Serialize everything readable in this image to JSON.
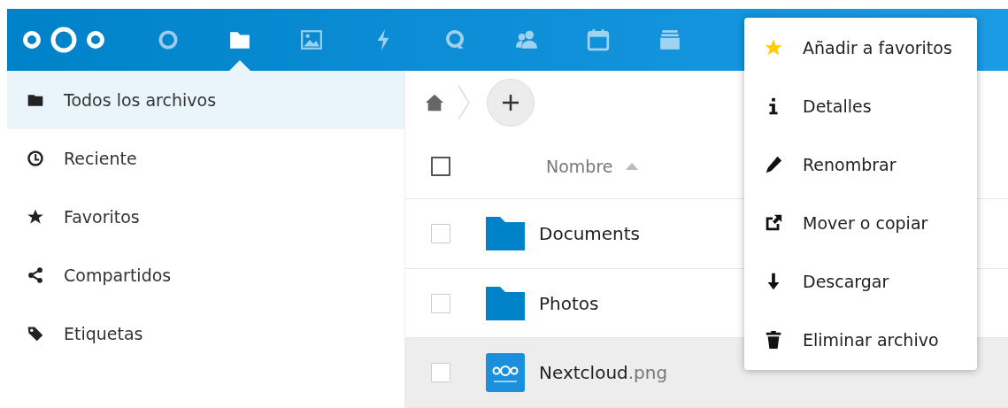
{
  "header": {
    "apps": [
      {
        "kind": "dashboard",
        "selected": false
      },
      {
        "kind": "files",
        "selected": true
      },
      {
        "kind": "photos",
        "selected": false
      },
      {
        "kind": "activity",
        "selected": false
      },
      {
        "kind": "talk",
        "selected": false
      },
      {
        "kind": "contacts",
        "selected": false
      },
      {
        "kind": "calendar",
        "selected": false
      },
      {
        "kind": "deck",
        "selected": false
      }
    ]
  },
  "sidebar": {
    "items": [
      {
        "kind": "folder",
        "label": "Todos los archivos",
        "selected": true
      },
      {
        "kind": "clock",
        "label": "Reciente",
        "selected": false
      },
      {
        "kind": "star",
        "label": "Favoritos",
        "selected": false
      },
      {
        "kind": "share",
        "label": "Compartidos",
        "selected": false
      },
      {
        "kind": "tag",
        "label": "Etiquetas",
        "selected": false
      }
    ]
  },
  "files": {
    "column": "Nombre",
    "all_checked": false,
    "rows": [
      {
        "kind": "folder",
        "name": "Documents",
        "extension": "",
        "selected": false,
        "checked": false
      },
      {
        "kind": "folder",
        "name": "Photos",
        "extension": "",
        "selected": false,
        "checked": false
      },
      {
        "kind": "image",
        "name": "Nextcloud",
        "extension": ".png",
        "selected": true,
        "checked": false
      }
    ]
  },
  "menu": {
    "items": [
      {
        "kind": "star",
        "label": "Añadir a favoritos"
      },
      {
        "kind": "info",
        "label": "Detalles"
      },
      {
        "kind": "pencil",
        "label": "Renombrar"
      },
      {
        "kind": "move",
        "label": "Mover o copiar"
      },
      {
        "kind": "download",
        "label": "Descargar"
      },
      {
        "kind": "trash",
        "label": "Eliminar archivo"
      }
    ]
  }
}
